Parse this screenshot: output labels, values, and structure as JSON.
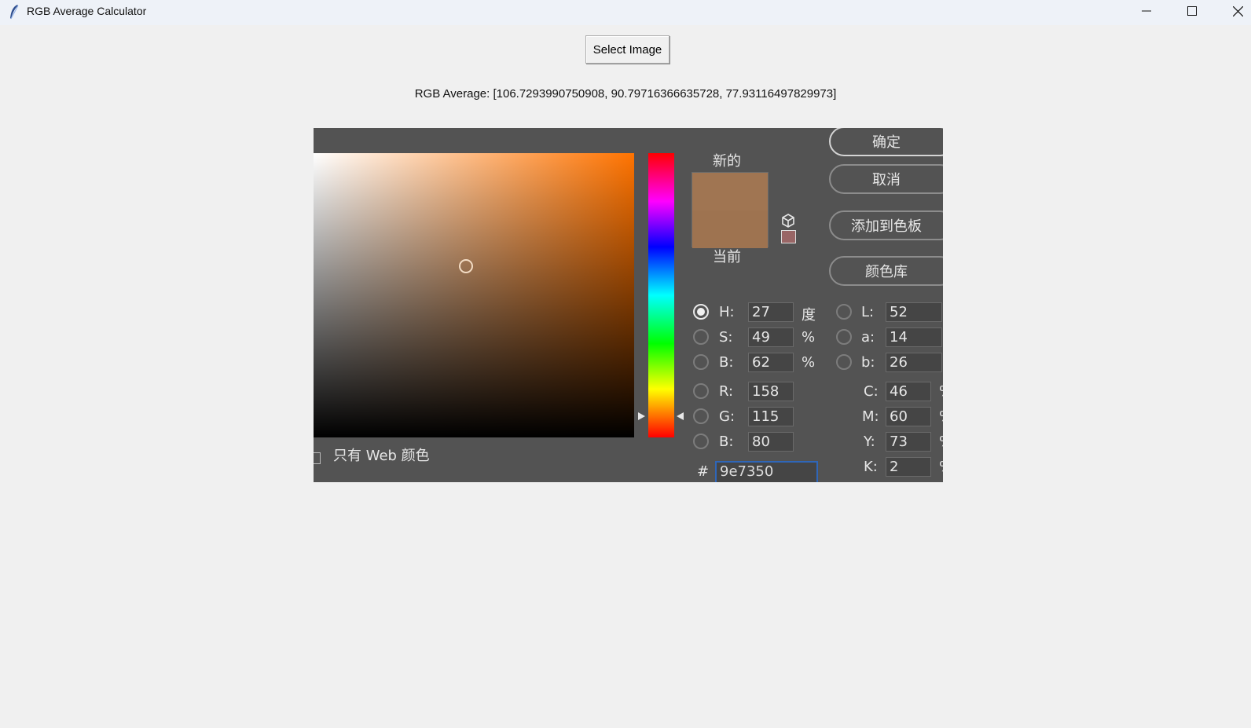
{
  "window": {
    "title": "RGB Average Calculator",
    "icon": "feather-icon",
    "controls": [
      "minimize-icon",
      "maximize-icon",
      "close-icon"
    ]
  },
  "toolbar": {
    "select_label": "Select Image"
  },
  "result": {
    "text": "RGB Average: [106.7293990750908, 90.79716366635728, 77.93116497829973]"
  },
  "picker": {
    "new_label": "新的",
    "current_label": "当前",
    "new_color": "#a07552",
    "current_color": "#9e7350",
    "field_hue_color": "#ff7300",
    "web_only_label": "只有 Web 颜色",
    "buttons": {
      "ok": "确定",
      "cancel": "取消",
      "add_swatch": "添加到色板",
      "library": "颜色库"
    },
    "hsb": [
      {
        "label": "H:",
        "value": "27",
        "unit": "度",
        "selected": true
      },
      {
        "label": "S:",
        "value": "49",
        "unit": "%",
        "selected": false
      },
      {
        "label": "B:",
        "value": "62",
        "unit": "%",
        "selected": false
      }
    ],
    "rgb": [
      {
        "label": "R:",
        "value": "158"
      },
      {
        "label": "G:",
        "value": "115"
      },
      {
        "label": "B:",
        "value": "80"
      }
    ],
    "lab": [
      {
        "label": "L:",
        "value": "52"
      },
      {
        "label": "a:",
        "value": "14"
      },
      {
        "label": "b:",
        "value": "26"
      }
    ],
    "cmyk": [
      {
        "label": "C:",
        "value": "46"
      },
      {
        "label": "M:",
        "value": "60"
      },
      {
        "label": "Y:",
        "value": "73"
      },
      {
        "label": "K:",
        "value": "2"
      }
    ],
    "hex_label": "#",
    "hex_value": "9e7350"
  }
}
